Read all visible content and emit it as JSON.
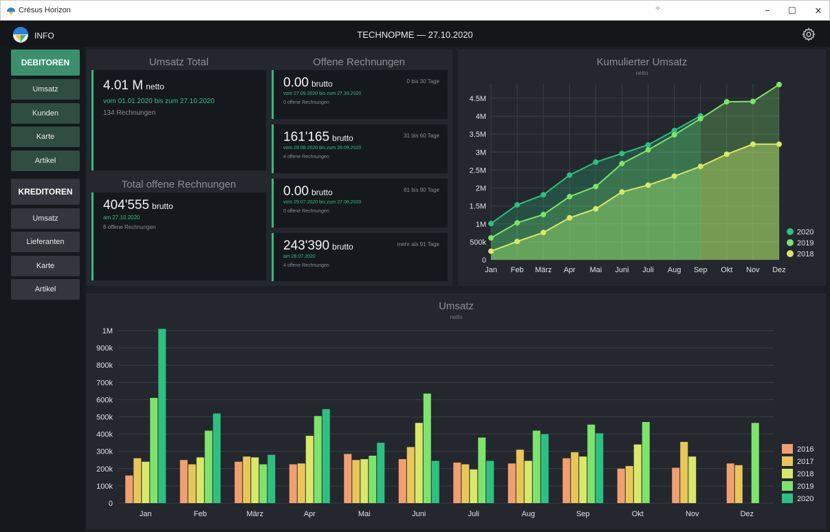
{
  "window": {
    "title": "Crésus Horizon",
    "minimize": "−",
    "maximize": "☐",
    "close": "✕"
  },
  "header": {
    "info_label": "INFO",
    "title": "TECHNOPME — 27.10.2020"
  },
  "sidebar": {
    "debitoren": "DEBITOREN",
    "debitoren_items": [
      "Umsatz",
      "Kunden",
      "Karte",
      "Artikel"
    ],
    "kreditoren": "KREDITOREN",
    "kreditoren_items": [
      "Umsatz",
      "Lieferanten",
      "Karte",
      "Artikel"
    ]
  },
  "umsatz_total": {
    "title": "Umsatz Total",
    "value": "4.01 M",
    "unit": "netto",
    "period": "vom 01.01.2020 bis zum 27.10.2020",
    "invoices": "134 Rechnungen"
  },
  "total_offene": {
    "title": "Total offene Rechnungen",
    "value": "404'555",
    "unit": "brutto",
    "date": "am 27.10.2020",
    "invoices": "8 offene Rechnungen"
  },
  "offene_rechnungen": {
    "title": "Offene Rechnungen",
    "cards": [
      {
        "value": "0.00",
        "unit": "brutto",
        "range": "0 bis 30 Tage",
        "period": "vom 27.09.2020 bis zum 27.10.2020",
        "count": "0 offene Rechnungen"
      },
      {
        "value": "161'165",
        "unit": "brutto",
        "range": "31 bis 60 Tage",
        "period": "vom 28.08.2020 bis zum 26.09.2020",
        "count": "4 offene Rechnungen"
      },
      {
        "value": "0.00",
        "unit": "brutto",
        "range": "61 bis 90 Tage",
        "period": "vom 29.07.2020 bis zum 27.08.2020",
        "count": "0 offene Rechnungen"
      },
      {
        "value": "243'390",
        "unit": "brutto",
        "range": "mehr als 91 Tage",
        "period": "am 28.07.2020",
        "count": "4 offene Rechnungen"
      }
    ]
  },
  "colors": {
    "accent": "#2fbf80",
    "y2016": "#f0a070",
    "y2017": "#e9c65a",
    "y2018": "#d9e86a",
    "y2019": "#7ee36d",
    "y2020": "#2fbf80"
  },
  "chart_data": [
    {
      "type": "area",
      "title": "Kumulierter Umsatz",
      "subtitle": "netto",
      "categories": [
        "Jan",
        "Feb",
        "März",
        "Apr",
        "Mai",
        "Juni",
        "Juli",
        "Aug",
        "Sep",
        "Okt",
        "Nov",
        "Dez"
      ],
      "y_ticks": [
        "0",
        "500k",
        "1M",
        "1.5M",
        "2M",
        "2.5M",
        "3M",
        "3.5M",
        "4M",
        "4.5M"
      ],
      "ylim": [
        0,
        4900000
      ],
      "legend_position": "bottom-right",
      "series": [
        {
          "name": "2020",
          "values": [
            1010000,
            1530000,
            1810000,
            2360000,
            2720000,
            2960000,
            3200000,
            3600000,
            4010000,
            null,
            null,
            null
          ]
        },
        {
          "name": "2019",
          "values": [
            610000,
            1030000,
            1260000,
            1760000,
            2040000,
            2680000,
            3060000,
            3480000,
            3930000,
            4400000,
            4410000,
            4880000
          ]
        },
        {
          "name": "2018",
          "values": [
            240000,
            510000,
            760000,
            1170000,
            1420000,
            1890000,
            2080000,
            2330000,
            2600000,
            2940000,
            3220000,
            3220000
          ]
        }
      ]
    },
    {
      "type": "bar",
      "title": "Umsatz",
      "subtitle": "netto",
      "categories": [
        "Jan",
        "Feb",
        "März",
        "Apr",
        "Mai",
        "Juni",
        "Juli",
        "Aug",
        "Sep",
        "Okt",
        "Nov",
        "Dez"
      ],
      "y_ticks": [
        "0",
        "100k",
        "200k",
        "300k",
        "400k",
        "500k",
        "600k",
        "700k",
        "800k",
        "900k",
        "1M"
      ],
      "ylim": [
        0,
        1000000
      ],
      "legend_position": "bottom-right",
      "series": [
        {
          "name": "2016",
          "values": [
            160000,
            250000,
            240000,
            225000,
            285000,
            255000,
            235000,
            230000,
            260000,
            200000,
            205000,
            230000
          ]
        },
        {
          "name": "2017",
          "values": [
            260000,
            225000,
            270000,
            230000,
            250000,
            325000,
            225000,
            310000,
            295000,
            215000,
            355000,
            220000
          ]
        },
        {
          "name": "2018",
          "values": [
            240000,
            265000,
            265000,
            390000,
            255000,
            465000,
            195000,
            245000,
            270000,
            340000,
            270000,
            0
          ]
        },
        {
          "name": "2019",
          "values": [
            610000,
            420000,
            225000,
            505000,
            275000,
            635000,
            380000,
            420000,
            455000,
            470000,
            0,
            465000
          ]
        },
        {
          "name": "2020",
          "values": [
            1010000,
            520000,
            280000,
            545000,
            350000,
            245000,
            245000,
            400000,
            405000,
            0,
            0,
            0
          ]
        }
      ]
    }
  ]
}
